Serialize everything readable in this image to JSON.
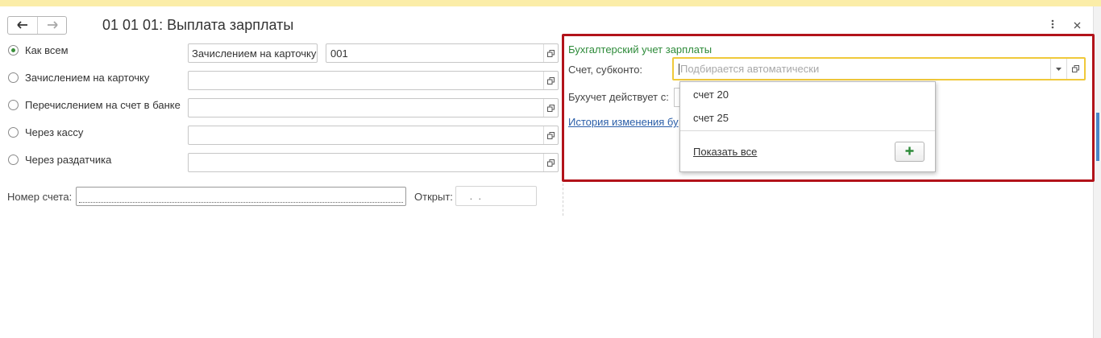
{
  "window": {
    "title": "01 01 01: Выплата зарплаты",
    "more_icon": "kebab-icon",
    "close_icon": "close-icon",
    "back_icon": "arrow-left-icon",
    "forward_icon": "arrow-right-icon"
  },
  "payment_options": [
    {
      "label": "Как всем",
      "selected": true
    },
    {
      "label": "Зачислением на карточку",
      "selected": false
    },
    {
      "label": "Перечислением на счет в банке",
      "selected": false
    },
    {
      "label": "Через кассу",
      "selected": false
    },
    {
      "label": "Через раздатчика",
      "selected": false
    }
  ],
  "default_method": {
    "value": "Зачислением на карточку",
    "code": "001"
  },
  "account": {
    "number_label": "Номер счета:",
    "number_value": "",
    "opened_label": "Открыт:",
    "opened_value": " .  ."
  },
  "accounting": {
    "heading": "Бухгалтерский учет зарплаты",
    "account_label": "Счет, субконто:",
    "account_placeholder": "Подбирается автоматически",
    "effective_label": "Бухучет действует с:",
    "history_link": "История изменения бу"
  },
  "dropdown": {
    "items": [
      "счет 20",
      "счет 25"
    ],
    "show_all_link": "Показать все",
    "add_icon": "plus-icon"
  },
  "colors": {
    "accent_green": "#2e8b3a",
    "highlight_red": "#b2131a",
    "focus_yellow": "#f0c93a",
    "link_blue": "#2a5ea8",
    "top_strip": "#fbeda8"
  }
}
